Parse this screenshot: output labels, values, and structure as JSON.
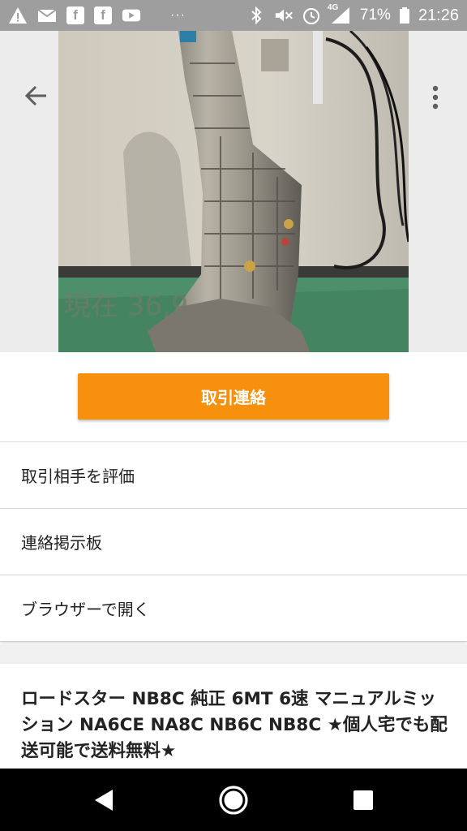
{
  "status_bar": {
    "notification_icons": [
      "warning-icon",
      "mail-icon",
      "facebook-icon",
      "facebook-icon",
      "youtube-icon"
    ],
    "more_indicator": "···",
    "system_icons": [
      "bluetooth-icon",
      "mute-icon",
      "alarm-icon",
      "signal-4g-icon"
    ],
    "network_label": "4G",
    "battery_percent": "71%",
    "time": "21:26"
  },
  "photo": {
    "watermark_text": "現在 36,9",
    "back_icon": "arrow-back-icon",
    "more_icon": "more-vert-icon"
  },
  "actions": {
    "primary_button_label": "取引連絡",
    "primary_color": "#f7900c"
  },
  "menu": {
    "items": [
      {
        "label": "取引相手を評価"
      },
      {
        "label": "連絡掲示板"
      },
      {
        "label": "ブラウザーで開く"
      }
    ]
  },
  "item": {
    "title": "ロードスター NB8C 純正 6MT 6速 マニュアルミッション NA6CE NA8C NB6C NB8C ★個人宅でも配送可能で送料無料★"
  },
  "nav_bar": {
    "back_icon": "nav-back-icon",
    "home_icon": "nav-home-icon",
    "recents_icon": "nav-recents-icon"
  }
}
